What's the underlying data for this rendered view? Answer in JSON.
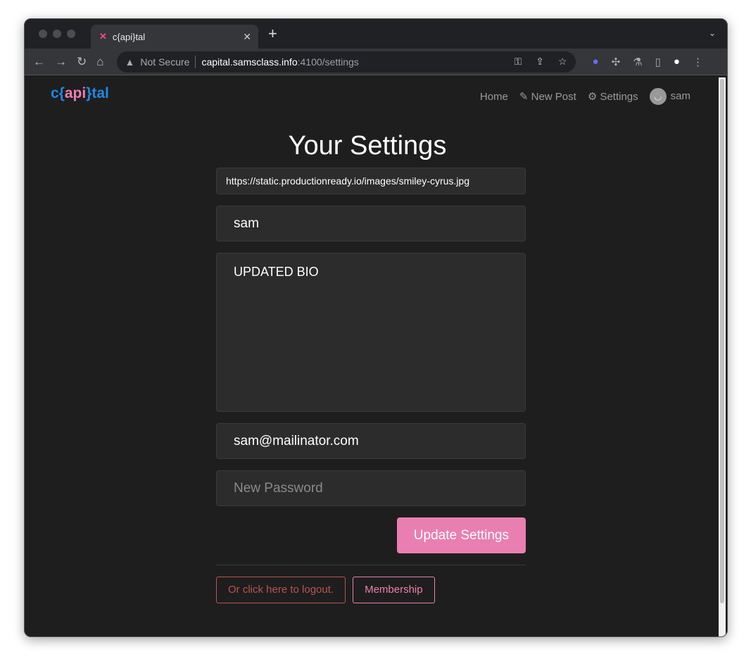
{
  "browser": {
    "tab_title": "c{api}tal",
    "url_security": "Not Secure",
    "url_host": "capital.samsclass.info",
    "url_rest": ":4100/settings"
  },
  "nav": {
    "brand_c": "c{",
    "brand_api": "api",
    "brand_tal": "}tal",
    "home": "Home",
    "new_post": "New Post",
    "settings": "Settings",
    "user": "sam"
  },
  "page": {
    "title": "Your Settings",
    "image_url": "https://static.productionready.io/images/smiley-cyrus.jpg",
    "username": "sam",
    "bio": "UPDATED BIO",
    "email": "sam@mailinator.com",
    "password_placeholder": "New Password",
    "update_button": "Update Settings",
    "logout_button": "Or click here to logout.",
    "membership_button": "Membership"
  },
  "colors": {
    "accent": "#e97fb0",
    "brand": "#1e88e5",
    "danger": "#b85450"
  }
}
